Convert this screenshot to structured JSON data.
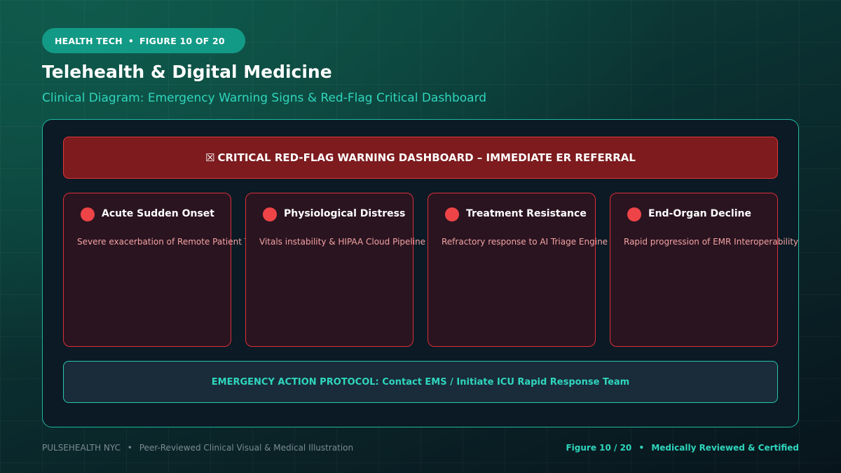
{
  "header": {
    "category": "HEALTH TECH",
    "figure_label": "FIGURE 10 OF 20",
    "separator": "•",
    "title": "Telehealth & Digital Medicine",
    "subtitle": "Clinical Diagram: Emergency Warning Signs & Red-Flag Critical Dashboard"
  },
  "banner": {
    "icon": "☒",
    "text": "CRITICAL RED-FLAG WARNING DASHBOARD – IMMEDIATE ER REFERRAL"
  },
  "cards": [
    {
      "title": "Acute Sudden Onset",
      "description": "Severe exacerbation of Remote Patient Telemetry"
    },
    {
      "title": "Physiological Distress",
      "description": "Vitals instability & HIPAA Cloud Pipeline"
    },
    {
      "title": "Treatment Resistance",
      "description": "Refractory response to AI Triage Engine"
    },
    {
      "title": "End-Organ Decline",
      "description": "Rapid progression of EMR Interoperability"
    }
  ],
  "protocol": {
    "text": "EMERGENCY ACTION PROTOCOL: Contact EMS / Initiate ICU Rapid Response Team"
  },
  "footer": {
    "brand": "PULSEHEALTH NYC",
    "separator": "•",
    "tagline": "Peer-Reviewed Clinical Visual & Medical Illustration",
    "figure": "Figure 10 / 20",
    "certification": "Medically Reviewed & Certified"
  },
  "colors": {
    "accent_teal": "#2fd6bd",
    "alert_red": "#ee4447",
    "banner_red": "#7d1b1e"
  }
}
